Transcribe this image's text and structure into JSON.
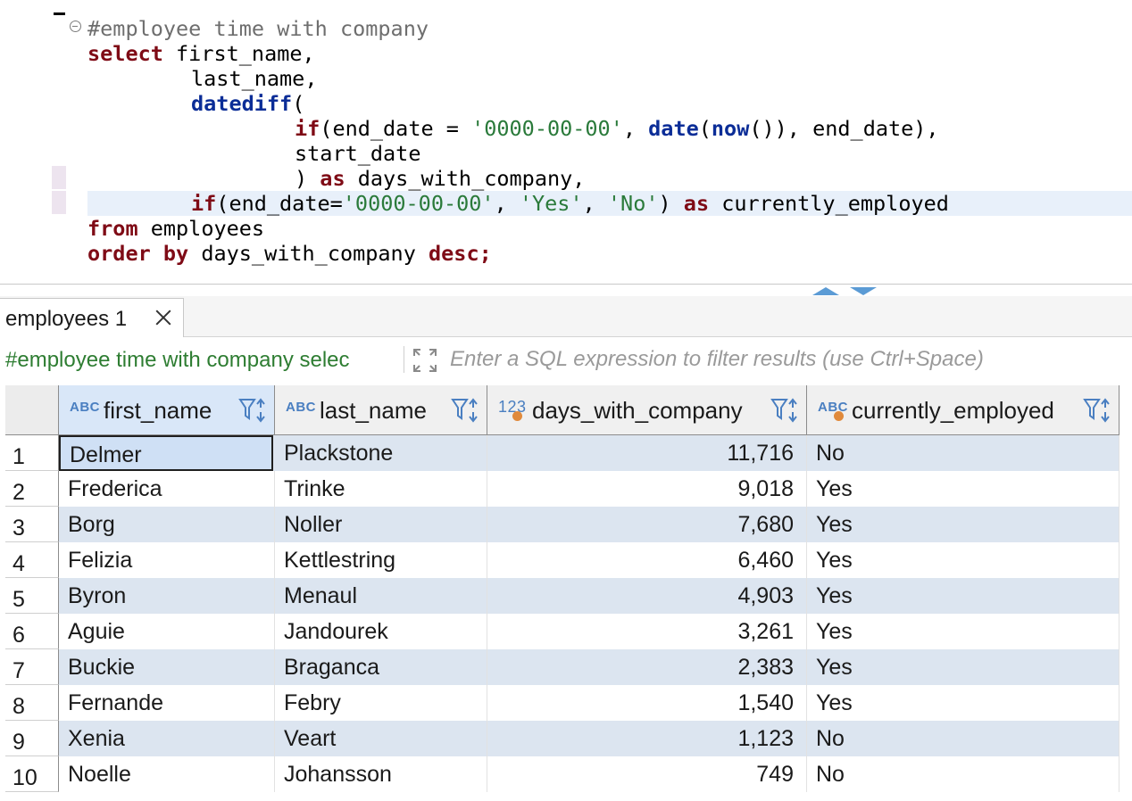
{
  "editor": {
    "comment": "#employee time with company",
    "lines": {
      "l1": {
        "kw": "select",
        "rest": " first_name,"
      },
      "l2": "last_name,",
      "l3": {
        "kw": "datediff",
        "rest": "("
      },
      "l4": {
        "kw_if": "if",
        "a": "(end_date = ",
        "s1": "'0000-00-00'",
        "b": ", ",
        "kw_date": "date",
        "c": "(",
        "kw_now": "now",
        "d": "()), end_date),"
      },
      "l5": "start_date",
      "l6": {
        "a": ") ",
        "kw": "as",
        "b": " days_with_company,"
      },
      "l7": {
        "kw_if": "if",
        "a": "(end_date=",
        "s1": "'0000-00-00'",
        "b": ", ",
        "s2": "'Yes'",
        "c": ", ",
        "s3": "'No'",
        "d": ") ",
        "kw_as": "as",
        "e": " currently_employed"
      },
      "l8": {
        "kw": "from",
        "rest": " employees"
      },
      "l9": {
        "kw": "order by",
        "rest": " days_with_company ",
        "kw2": "desc",
        "semi": ";"
      }
    }
  },
  "results_tab": {
    "label": "employees 1"
  },
  "filter": {
    "query": "#employee time with company selec",
    "placeholder": "Enter a SQL expression to filter results (use Ctrl+Space)"
  },
  "grid": {
    "columns": [
      {
        "type_icon": "ABC",
        "name": "first_name"
      },
      {
        "type_icon": "ABC",
        "name": "last_name"
      },
      {
        "type_icon": "123",
        "name": "days_with_company"
      },
      {
        "type_icon": "ABC",
        "name": "currently_employed"
      }
    ],
    "rows": [
      {
        "num": "1",
        "first_name": "Delmer",
        "last_name": "Plackstone",
        "days": "11,716",
        "employed": "No"
      },
      {
        "num": "2",
        "first_name": "Frederica",
        "last_name": "Trinke",
        "days": "9,018",
        "employed": "Yes"
      },
      {
        "num": "3",
        "first_name": "Borg",
        "last_name": "Noller",
        "days": "7,680",
        "employed": "Yes"
      },
      {
        "num": "4",
        "first_name": "Felizia",
        "last_name": "Kettlestring",
        "days": "6,460",
        "employed": "Yes"
      },
      {
        "num": "5",
        "first_name": "Byron",
        "last_name": "Menaul",
        "days": "4,903",
        "employed": "Yes"
      },
      {
        "num": "6",
        "first_name": "Aguie",
        "last_name": "Jandourek",
        "days": "3,261",
        "employed": "Yes"
      },
      {
        "num": "7",
        "first_name": "Buckie",
        "last_name": "Braganca",
        "days": "2,383",
        "employed": "Yes"
      },
      {
        "num": "8",
        "first_name": "Fernande",
        "last_name": "Febry",
        "days": "1,540",
        "employed": "Yes"
      },
      {
        "num": "9",
        "first_name": "Xenia",
        "last_name": "Veart",
        "days": "1,123",
        "employed": "No"
      },
      {
        "num": "10",
        "first_name": "Noelle",
        "last_name": "Johansson",
        "days": "749",
        "employed": "No"
      }
    ]
  },
  "colors": {
    "keyword": "#7f0b16",
    "function": "#0b2d97",
    "string": "#2a7a3a",
    "row_alt": "#dce5f0",
    "accent": "#4a7fc1"
  }
}
